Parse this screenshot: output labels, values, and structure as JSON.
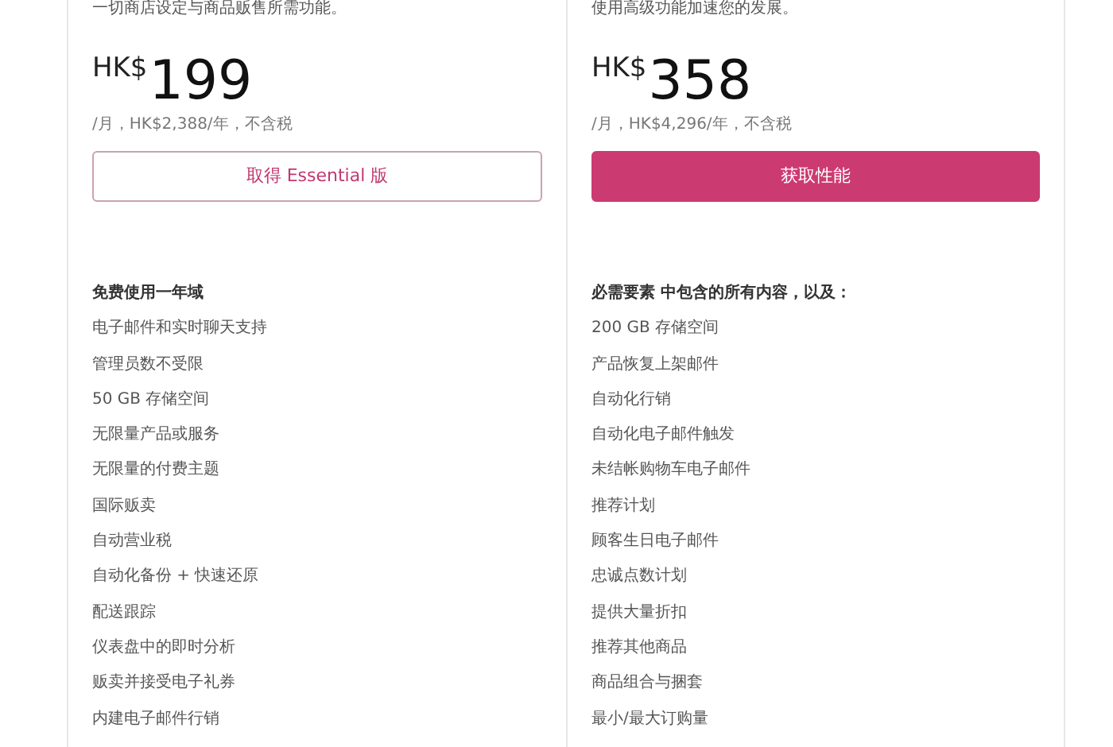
{
  "plans": [
    {
      "description": "一切商店设定与商品贩售所需功能。",
      "currency": "HK$",
      "price": "199",
      "billing": "/月，HK$2,388/年，不含税",
      "button": {
        "label": "取得 Essential 版",
        "kind": "outline"
      },
      "features": [
        {
          "kind": "heading",
          "text": "免费使用一年域"
        },
        {
          "kind": "item",
          "text": "电子邮件和实时聊天支持"
        },
        {
          "kind": "item",
          "text": "管理员数不受限"
        },
        {
          "kind": "item",
          "text": "50 GB 存储空间"
        },
        {
          "kind": "item",
          "text": "无限量产品或服务"
        },
        {
          "kind": "item",
          "text": "无限量的付费主题"
        },
        {
          "kind": "item",
          "text": "国际贩卖"
        },
        {
          "kind": "item",
          "text": "自动营业税"
        },
        {
          "kind": "item",
          "text": "自动化备份 + 快速还原"
        },
        {
          "kind": "item",
          "text": "配送跟踪"
        },
        {
          "kind": "item",
          "text": "仪表盘中的即时分析"
        },
        {
          "kind": "item",
          "text": "贩卖并接受电子礼券"
        },
        {
          "kind": "item",
          "text": "内建电子邮件行销"
        }
      ]
    },
    {
      "description": "使用高级功能加速您的发展。",
      "currency": "HK$",
      "price": "358",
      "billing": "/月，HK$4,296/年，不含税",
      "button": {
        "label": "获取性能",
        "kind": "filled"
      },
      "features": [
        {
          "kind": "heading",
          "text": "必需要素 中包含的所有内容，以及："
        },
        {
          "kind": "item",
          "text": "200 GB 存储空间"
        },
        {
          "kind": "item",
          "text": "产品恢复上架邮件"
        },
        {
          "kind": "item",
          "text": "自动化行销"
        },
        {
          "kind": "item",
          "text": "自动化电子邮件触发"
        },
        {
          "kind": "item",
          "text": "未结帐购物车电子邮件"
        },
        {
          "kind": "item",
          "text": "推荐计划"
        },
        {
          "kind": "item",
          "text": "顾客生日电子邮件"
        },
        {
          "kind": "item",
          "text": "忠诚点数计划"
        },
        {
          "kind": "item",
          "text": "提供大量折扣"
        },
        {
          "kind": "item",
          "text": "推荐其他商品"
        },
        {
          "kind": "item",
          "text": "商品组合与捆套"
        },
        {
          "kind": "item",
          "text": "最小/最大订购量"
        }
      ]
    }
  ]
}
